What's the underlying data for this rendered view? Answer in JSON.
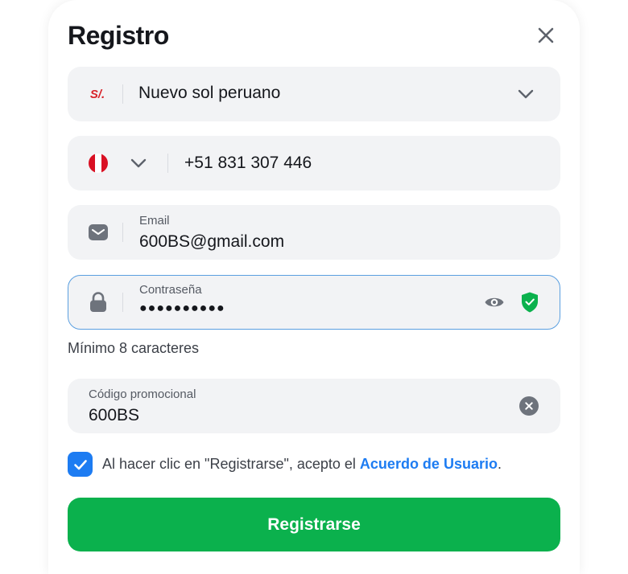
{
  "dialog": {
    "title": "Registro"
  },
  "currency": {
    "symbol": "S/.",
    "value": "Nuevo sol peruano"
  },
  "phone": {
    "value": "+51 831 307 446"
  },
  "email": {
    "label": "Email",
    "value": "600BS@gmail.com"
  },
  "password": {
    "label": "Contraseña",
    "value": "●●●●●●●●●●",
    "hint": "Mínimo 8 caracteres"
  },
  "promo": {
    "label": "Código promocional",
    "value": "600BS"
  },
  "terms": {
    "checked": true,
    "text_before": "Al hacer clic en \"Registrarse\", acepto el ",
    "link": "Acuerdo de Usuario",
    "text_after": "."
  },
  "submit": {
    "label": "Registrarse"
  },
  "colors": {
    "primary": "#0bb14d",
    "link": "#1d7cf2",
    "focus_border": "#5a9fe0",
    "field_bg": "#f2f3f5",
    "currency_red": "#d8232a",
    "flag_red": "#d91023",
    "shield_green": "#0bb14d"
  },
  "icons": {
    "close": "close-icon",
    "currency_chevron": "chevron-down-icon",
    "country_chevron": "chevron-down-icon",
    "email": "envelope-icon",
    "password": "lock-icon",
    "show_password": "eye-icon",
    "password_strength": "shield-check-icon",
    "clear_promo": "clear-circle-icon",
    "checkbox": "checkmark-icon",
    "flag": "peru-flag-icon"
  }
}
